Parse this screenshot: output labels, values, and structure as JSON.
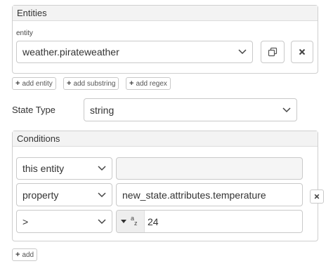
{
  "entities_panel": {
    "title": "Entities",
    "entity_label": "entity",
    "entity_value": "weather.pirateweather"
  },
  "buttons": {
    "add_entity": "add entity",
    "add_substring": "add substring",
    "add_regex": "add regex",
    "add": "add"
  },
  "state_type": {
    "label": "State Type",
    "value": "string"
  },
  "conditions_panel": {
    "title": "Conditions",
    "rows": [
      {
        "type": "this entity",
        "value": ""
      },
      {
        "type": "property",
        "value": "new_state.attributes.temperature"
      },
      {
        "type": ">",
        "value": "24"
      }
    ]
  },
  "icons": {
    "copy": "copy-icon",
    "clear": "close-icon",
    "remove": "close-icon",
    "dropdown": "chevron-down-icon",
    "type_selector": "az-type-icon"
  }
}
